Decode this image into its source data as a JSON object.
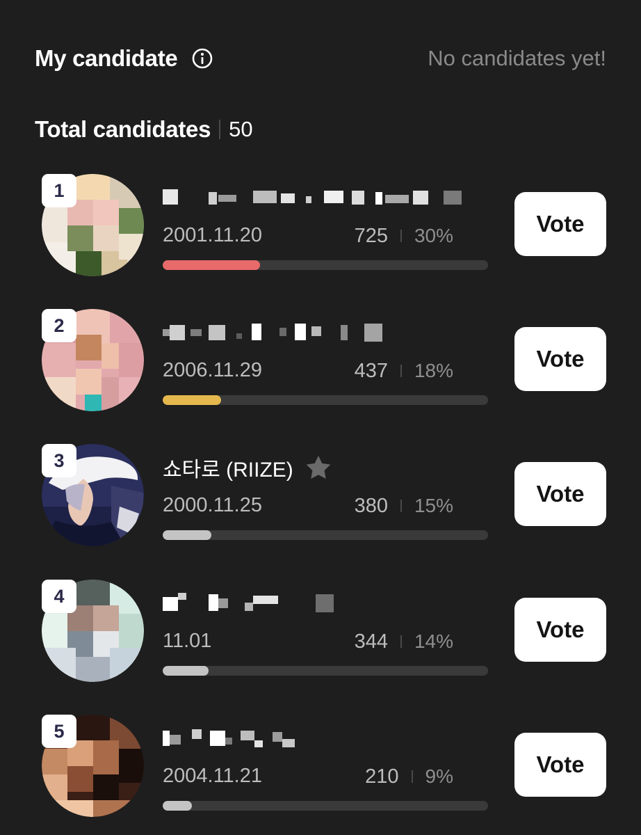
{
  "header": {
    "my_candidate_label": "My candidate",
    "no_candidates_text": "No candidates yet!",
    "total_label": "Total candidates",
    "total_count": "50",
    "info_icon": "info-icon"
  },
  "colors": {
    "background": "#1e1e1e",
    "rank1_bar": "#e86a6a",
    "rank2_bar": "#e4b84e",
    "default_bar": "#c4c4c4",
    "track": "#3a3a3a"
  },
  "candidates": [
    {
      "rank": "1",
      "name": "",
      "name_censored": true,
      "birth": "2001.11.20",
      "votes": "725",
      "percent": "30%",
      "progress": 0.3,
      "bar_color": "#e86a6a",
      "vote_label": "Vote"
    },
    {
      "rank": "2",
      "name": "",
      "name_censored": true,
      "birth": "2006.11.29",
      "votes": "437",
      "percent": "18%",
      "progress": 0.18,
      "bar_color": "#e4b84e",
      "vote_label": "Vote"
    },
    {
      "rank": "3",
      "name": "쇼타로 (RIIZE)",
      "name_censored": false,
      "birth": "2000.11.25",
      "votes": "380",
      "percent": "15%",
      "progress": 0.15,
      "bar_color": "#c4c4c4",
      "vote_label": "Vote",
      "star_icon": "star-icon"
    },
    {
      "rank": "4",
      "name": "",
      "name_censored": true,
      "birth": "11.01",
      "votes": "344",
      "percent": "14%",
      "progress": 0.14,
      "bar_color": "#c4c4c4",
      "vote_label": "Vote"
    },
    {
      "rank": "5",
      "name": "",
      "name_censored": true,
      "birth": "2004.11.21",
      "votes": "210",
      "percent": "9%",
      "progress": 0.09,
      "bar_color": "#c4c4c4",
      "vote_label": "Vote"
    }
  ]
}
